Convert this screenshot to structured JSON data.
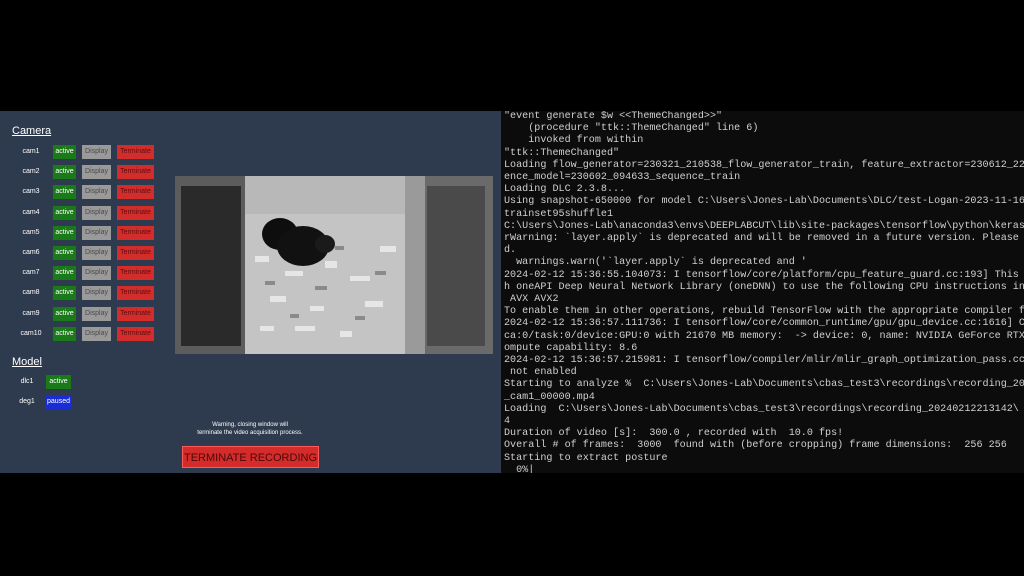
{
  "app": {
    "camera_section_title": "Camera",
    "model_section_title": "Model",
    "cameras": [
      {
        "name": "cam1",
        "status": "active",
        "display_label": "Display",
        "terminate_label": "Terminate"
      },
      {
        "name": "cam2",
        "status": "active",
        "display_label": "Display",
        "terminate_label": "Terminate"
      },
      {
        "name": "cam3",
        "status": "active",
        "display_label": "Display",
        "terminate_label": "Terminate"
      },
      {
        "name": "cam4",
        "status": "active",
        "display_label": "Display",
        "terminate_label": "Terminate"
      },
      {
        "name": "cam5",
        "status": "active",
        "display_label": "Display",
        "terminate_label": "Terminate"
      },
      {
        "name": "cam6",
        "status": "active",
        "display_label": "Display",
        "terminate_label": "Terminate"
      },
      {
        "name": "cam7",
        "status": "active",
        "display_label": "Display",
        "terminate_label": "Terminate"
      },
      {
        "name": "cam8",
        "status": "active",
        "display_label": "Display",
        "terminate_label": "Terminate"
      },
      {
        "name": "cam9",
        "status": "active",
        "display_label": "Display",
        "terminate_label": "Terminate"
      },
      {
        "name": "cam10",
        "status": "active",
        "display_label": "Display",
        "terminate_label": "Terminate"
      }
    ],
    "models": [
      {
        "name": "dlc1",
        "status": "active"
      },
      {
        "name": "deg1",
        "status": "paused"
      }
    ],
    "warning_line1": "Warning, closing window will",
    "warning_line2": "terminate the video acquisition process.",
    "terminate_recording_label": "TERMINATE RECORDING",
    "colors": {
      "panel_bg": "#2e3a4e",
      "active_green": "#1a7a1a",
      "paused_blue": "#1a2dd4",
      "terminate_red": "#d42b2b",
      "display_gray": "#9a9a9a"
    }
  },
  "console": {
    "lines": [
      "\"event generate $w <<ThemeChanged>>\"",
      "    (procedure \"ttk::ThemeChanged\" line 6)",
      "    invoked from within",
      "\"ttk::ThemeChanged\"",
      "Loading flow_generator=230321_210538_flow_generator_train, feature_extractor=230612_22",
      "ence_model=230602_094633_sequence_train",
      "Loading DLC 2.3.8...",
      "Using snapshot-650000 for model C:\\Users\\Jones-Lab\\Documents\\DLC/test-Logan-2023-11-16",
      "trainset95shuffle1",
      "C:\\Users\\Jones-Lab\\anaconda3\\envs\\DEEPLABCUT\\lib\\site-packages\\tensorflow\\python\\keras",
      "rWarning: `layer.apply` is deprecated and will be removed in a future version. Please",
      "d.",
      "  warnings.warn('`layer.apply` is deprecated and '",
      "2024-02-12 15:36:55.104073: I tensorflow/core/platform/cpu_feature_guard.cc:193] This",
      "h oneAPI Deep Neural Network Library (oneDNN) to use the following CPU instructions in",
      " AVX AVX2",
      "To enable them in other operations, rebuild TensorFlow with the appropriate compiler f",
      "2024-02-12 15:36:57.111736: I tensorflow/core/common_runtime/gpu/gpu_device.cc:1616] C",
      "ca:0/task:0/device:GPU:0 with 21670 MB memory:  -> device: 0, name: NVIDIA GeForce RTX",
      "ompute capability: 8.6",
      "2024-02-12 15:36:57.215981: I tensorflow/compiler/mlir/mlir_graph_optimization_pass.cc",
      " not enabled",
      "Starting to analyze %  C:\\Users\\Jones-Lab\\Documents\\cbas_test3\\recordings\\recording_20",
      "_cam1_00000.mp4",
      "Loading  C:\\Users\\Jones-Lab\\Documents\\cbas_test3\\recordings\\recording_20240212213142\\",
      "4",
      "Duration of video [s]:  300.0 , recorded with  10.0 fps!",
      "Overall # of frames:  3000  found with (before cropping) frame dimensions:  256 256",
      "Starting to extract posture",
      "  0%|"
    ]
  }
}
